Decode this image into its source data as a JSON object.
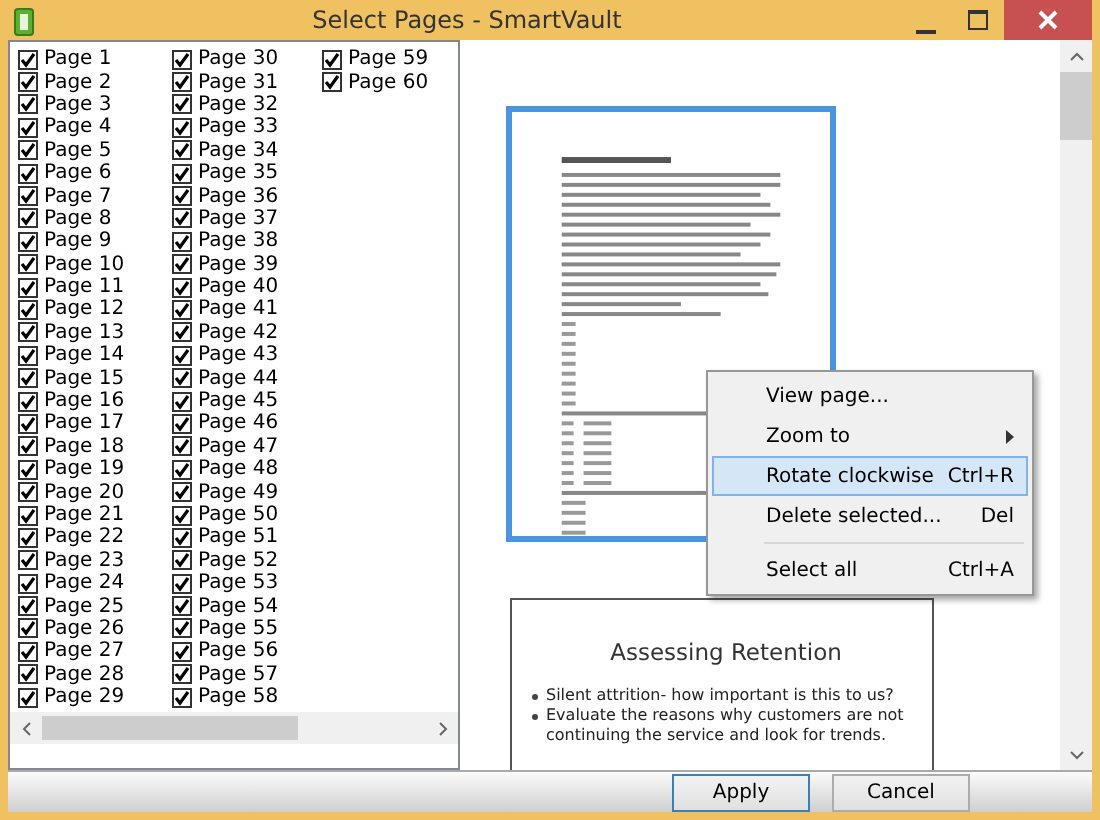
{
  "window": {
    "title": "Select Pages - SmartVault"
  },
  "pages": [
    {
      "label": "Page 1",
      "checked": true
    },
    {
      "label": "Page 2",
      "checked": true
    },
    {
      "label": "Page 3",
      "checked": true
    },
    {
      "label": "Page 4",
      "checked": true
    },
    {
      "label": "Page 5",
      "checked": true
    },
    {
      "label": "Page 6",
      "checked": true
    },
    {
      "label": "Page 7",
      "checked": true
    },
    {
      "label": "Page 8",
      "checked": true
    },
    {
      "label": "Page 9",
      "checked": true
    },
    {
      "label": "Page 10",
      "checked": true
    },
    {
      "label": "Page 11",
      "checked": true
    },
    {
      "label": "Page 12",
      "checked": true
    },
    {
      "label": "Page 13",
      "checked": true
    },
    {
      "label": "Page 14",
      "checked": true
    },
    {
      "label": "Page 15",
      "checked": true
    },
    {
      "label": "Page 16",
      "checked": true
    },
    {
      "label": "Page 17",
      "checked": true
    },
    {
      "label": "Page 18",
      "checked": true
    },
    {
      "label": "Page 19",
      "checked": true
    },
    {
      "label": "Page 20",
      "checked": true
    },
    {
      "label": "Page 21",
      "checked": true
    },
    {
      "label": "Page 22",
      "checked": true
    },
    {
      "label": "Page 23",
      "checked": true
    },
    {
      "label": "Page 24",
      "checked": true
    },
    {
      "label": "Page 25",
      "checked": true
    },
    {
      "label": "Page 26",
      "checked": true
    },
    {
      "label": "Page 27",
      "checked": true
    },
    {
      "label": "Page 28",
      "checked": true
    },
    {
      "label": "Page 29",
      "checked": true
    },
    {
      "label": "Page 30",
      "checked": true
    },
    {
      "label": "Page 31",
      "checked": true
    },
    {
      "label": "Page 32",
      "checked": true
    },
    {
      "label": "Page 33",
      "checked": true
    },
    {
      "label": "Page 34",
      "checked": true
    },
    {
      "label": "Page 35",
      "checked": true
    },
    {
      "label": "Page 36",
      "checked": true
    },
    {
      "label": "Page 37",
      "checked": true
    },
    {
      "label": "Page 38",
      "checked": true
    },
    {
      "label": "Page 39",
      "checked": true
    },
    {
      "label": "Page 40",
      "checked": true
    },
    {
      "label": "Page 41",
      "checked": true
    },
    {
      "label": "Page 42",
      "checked": true
    },
    {
      "label": "Page 43",
      "checked": true
    },
    {
      "label": "Page 44",
      "checked": true
    },
    {
      "label": "Page 45",
      "checked": true
    },
    {
      "label": "Page 46",
      "checked": true
    },
    {
      "label": "Page 47",
      "checked": true
    },
    {
      "label": "Page 48",
      "checked": true
    },
    {
      "label": "Page 49",
      "checked": true
    },
    {
      "label": "Page 50",
      "checked": true
    },
    {
      "label": "Page 51",
      "checked": true
    },
    {
      "label": "Page 52",
      "checked": true
    },
    {
      "label": "Page 53",
      "checked": true
    },
    {
      "label": "Page 54",
      "checked": true
    },
    {
      "label": "Page 55",
      "checked": true
    },
    {
      "label": "Page 56",
      "checked": true
    },
    {
      "label": "Page 57",
      "checked": true
    },
    {
      "label": "Page 58",
      "checked": true
    },
    {
      "label": "Page 59",
      "checked": true
    },
    {
      "label": "Page 60",
      "checked": true
    }
  ],
  "preview": {
    "thumbnails": [
      {
        "kind": "document",
        "selected": true
      },
      {
        "kind": "slide",
        "selected": false,
        "title": "Assessing Retention",
        "bullets": [
          "Silent attrition- how important is this to us?",
          "Evaluate the reasons why customers are not continuing the service and look for trends."
        ]
      }
    ]
  },
  "context_menu": {
    "items": [
      {
        "kind": "item",
        "label": "View page...",
        "selected": false
      },
      {
        "kind": "submenu",
        "label": "Zoom to",
        "selected": false
      },
      {
        "kind": "item",
        "label": "Rotate clockwise",
        "shortcut": "Ctrl+R",
        "selected": true
      },
      {
        "kind": "item",
        "label": "Delete selected...",
        "shortcut": "Del",
        "selected": false
      },
      {
        "kind": "separator"
      },
      {
        "kind": "item",
        "label": "Select all",
        "shortcut": "Ctrl+A",
        "selected": false
      }
    ]
  },
  "buttons": [
    {
      "label": "Apply",
      "default": true
    },
    {
      "label": "Cancel",
      "default": false
    }
  ]
}
